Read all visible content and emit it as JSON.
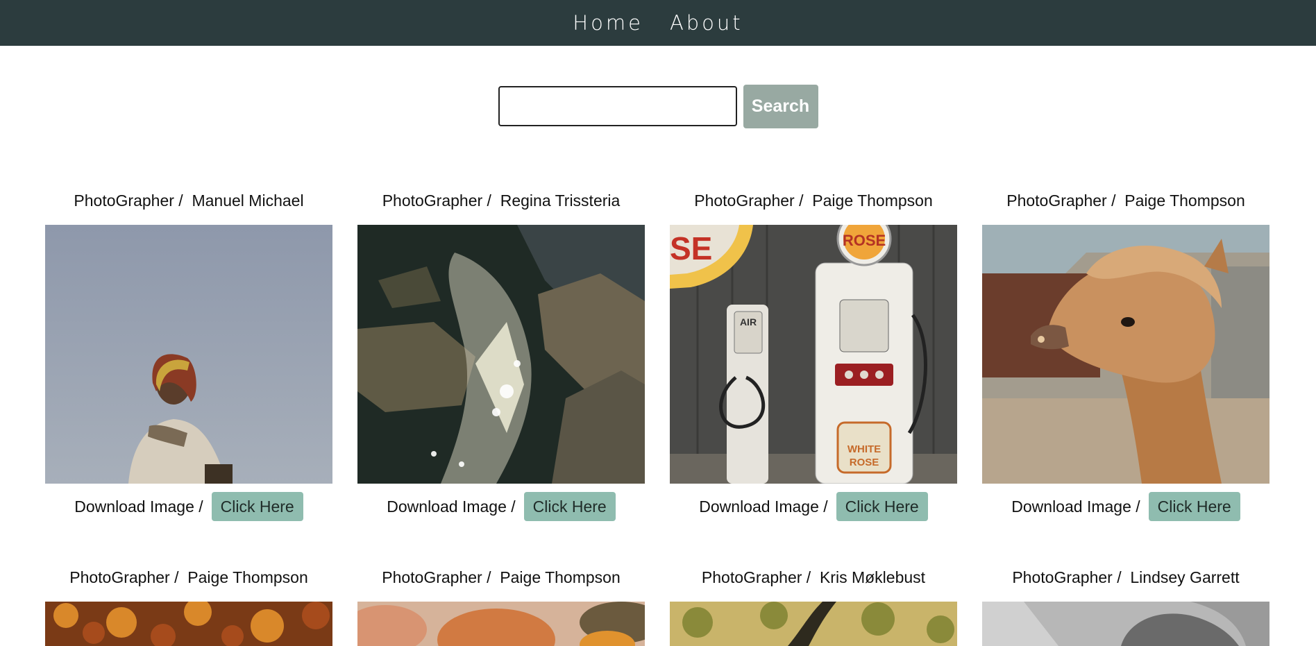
{
  "nav": {
    "items": [
      "Home",
      "About"
    ]
  },
  "search": {
    "value": "",
    "placeholder": "",
    "button_label": "Search"
  },
  "cards": [
    {
      "prefix": "PhotoGrapher /",
      "name": "Manuel Michael",
      "download_label": "Download Image /",
      "button_label": "Click Here",
      "image": "person-portrait-photo"
    },
    {
      "prefix": "PhotoGrapher /",
      "name": "Regina Trissteria",
      "download_label": "Download Image /",
      "button_label": "Click Here",
      "image": "stream-rocks-photo"
    },
    {
      "prefix": "PhotoGrapher /",
      "name": "Paige Thompson",
      "download_label": "Download Image /",
      "button_label": "Click Here",
      "image": "gas-pump-photo"
    },
    {
      "prefix": "PhotoGrapher /",
      "name": "Paige Thompson",
      "download_label": "Download Image /",
      "button_label": "Click Here",
      "image": "alpaca-photo"
    },
    {
      "prefix": "PhotoGrapher /",
      "name": "Paige Thompson",
      "image": "autumn-forest-photo"
    },
    {
      "prefix": "PhotoGrapher /",
      "name": "Paige Thompson",
      "image": "pumpkins-photo"
    },
    {
      "prefix": "PhotoGrapher /",
      "name": "Kris Møklebust",
      "image": "tree-foliage-photo"
    },
    {
      "prefix": "PhotoGrapher /",
      "name": "Lindsey Garrett",
      "image": "black-white-photo"
    }
  ],
  "photo_text": {
    "pump_sign": "SE",
    "pump_brand": "ROSE",
    "pump_air": "AIR",
    "pump_white": "WHITE",
    "pump_rose": "ROSE"
  },
  "colors": {
    "navbar": "#2c3c3e",
    "search_button": "#98a9a2",
    "click_button": "#8fbcaf"
  }
}
